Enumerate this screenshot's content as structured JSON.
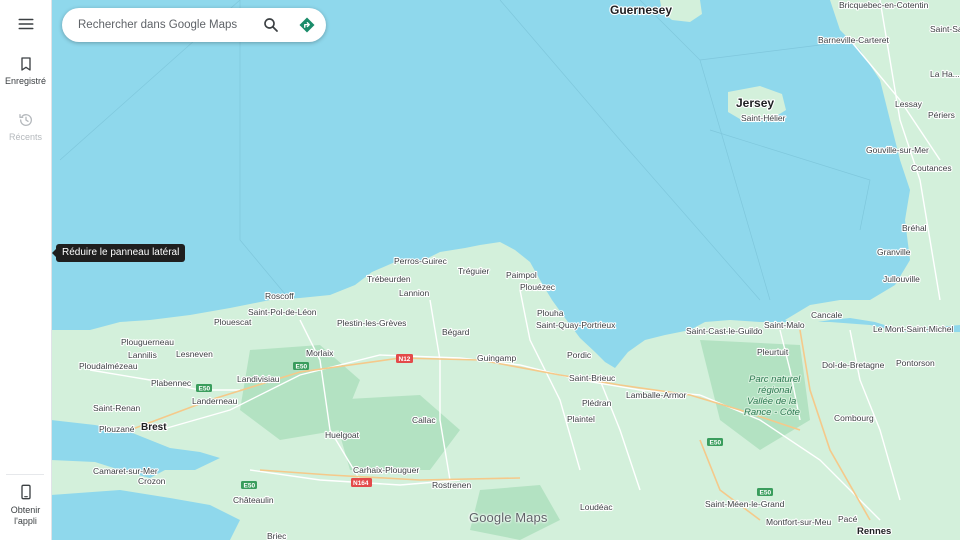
{
  "sidebar": {
    "menu_icon": "hamburger-menu-icon",
    "saved": {
      "label": "Enregistré",
      "icon": "bookmark-icon"
    },
    "recents": {
      "label": "Récents",
      "icon": "history-icon"
    },
    "get_app": {
      "label_line1": "Obtenir",
      "label_line2": "l'appli",
      "icon": "phone-icon"
    }
  },
  "search": {
    "placeholder": "Rechercher dans Google Maps",
    "value": "",
    "search_icon": "search-icon",
    "directions_icon": "directions-icon"
  },
  "tooltip": {
    "text": "Réduire le panneau latéral"
  },
  "logo": {
    "text": "Google Maps"
  },
  "colors": {
    "sea": "#8fd8ec",
    "land": "#d3f0db",
    "forest": "#b3e2c2",
    "accent_green": "#1a8c6a",
    "road_badge": "#e34a4a",
    "road_badge_green": "#3a9d5d"
  },
  "map": {
    "islands": {
      "guernsey": "Guernesey",
      "jersey": "Jersey",
      "saint_helier": "Saint-Hélier"
    },
    "places": {
      "bricquebec": "Bricquebec-en-Cotentin",
      "saint_sauveur": "Saint-Sa...",
      "barneville": "Barneville-Carteret",
      "la_haye": "La Ha...",
      "lessay": "Lessay",
      "periers": "Périers",
      "gouville": "Gouville-sur-Mer",
      "coutances": "Coutances",
      "brehal": "Bréhal",
      "granville": "Granville",
      "jullouville": "Jullouville",
      "perros": "Perros-Guirec",
      "treguier": "Tréguier",
      "paimpol": "Paimpol",
      "trebeurden": "Trébeurden",
      "lannion": "Lannion",
      "plouezec": "Plouézec",
      "roscoff": "Roscoff",
      "plouha": "Plouha",
      "saint_pol": "Saint-Pol-de-Léon",
      "plouescat": "Plouescat",
      "plestin": "Plestin-les-Grèves",
      "saint_quay": "Saint-Quay-Portrieux",
      "begard": "Bégard",
      "saint_cast": "Saint-Cast-le-Guildo",
      "saint_malo": "Saint-Malo",
      "cancale": "Cancale",
      "mont_saint_michel": "Le Mont-Saint-Michel",
      "plouguerneau": "Plouguerneau",
      "lannilis": "Lannilis",
      "lesneven": "Lesneven",
      "morlaix": "Morlaix",
      "guingamp": "Guingamp",
      "pordic": "Pordic",
      "pleurtuit": "Pleurtuit",
      "dol": "Dol-de-Bretagne",
      "pontorson": "Pontorson",
      "ploudalmezeau": "Ploudalmézeau",
      "landivisiau": "Landivisiau",
      "saint_brieuc": "Saint-Brieuc",
      "plabennec": "Plabennec",
      "lamballe": "Lamballe-Armor",
      "parc_1": "Parc naturel",
      "parc_2": "régional",
      "parc_3": "Vallée de la",
      "parc_4": "Rance - Côte",
      "landerneau": "Landerneau",
      "ploufragan": "Plédran",
      "saint_renan": "Saint-Renan",
      "combourg": "Combourg",
      "callac": "Callac",
      "plaintel": "Plaintel",
      "plouzane": "Plouzané",
      "brest": "Brest",
      "huelgoat": "Huelgoat",
      "carhaix": "Carhaix-Plouguer",
      "camaret": "Camaret-sur-Mer",
      "crozon": "Crozon",
      "rostrenen": "Rostrenen",
      "chateaulin": "Châteaulin",
      "saint_meen": "Saint-Méen-le-Grand",
      "loudeac": "Loudéac",
      "montfort": "Montfort-sur-Meu",
      "pace": "Pacé",
      "rennes": "Rennes",
      "briec": "Briec"
    },
    "roads": {
      "n12": "N12",
      "n164": "N164",
      "e50_a": "E50",
      "e50_b": "E50",
      "e50_c": "E50",
      "e50_d": "E50",
      "e50_e": "E50"
    }
  }
}
